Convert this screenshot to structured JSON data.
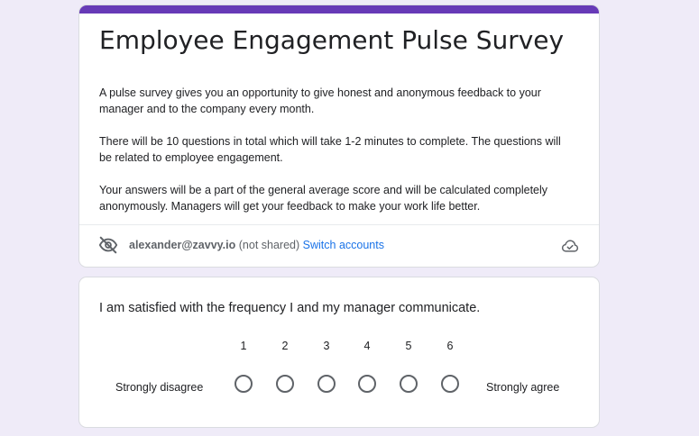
{
  "form": {
    "title": "Employee Engagement Pulse Survey",
    "description": [
      "A pulse survey gives you an opportunity to give honest and anonymous feedback to your manager and to the company every month.",
      "There will be 10 questions in total which will take 1-2 minutes to complete. The questions will be related to employee engagement.",
      "Your answers will be a part of the general average score and will be calculated completely anonymously. Managers will get your feedback to make your work life better."
    ],
    "accent_color": "#673ab7"
  },
  "account": {
    "email": "alexander@zavvy.io",
    "shared_status": "(not shared)",
    "switch_label": "Switch accounts",
    "privacy_icon": "eye-off-icon",
    "save_status_icon": "cloud-done-icon"
  },
  "question": {
    "text": "I am satisfied with the frequency I and my manager communicate.",
    "scale": [
      "1",
      "2",
      "3",
      "4",
      "5",
      "6"
    ],
    "low_label": "Strongly disagree",
    "high_label": "Strongly agree",
    "selected": null
  }
}
